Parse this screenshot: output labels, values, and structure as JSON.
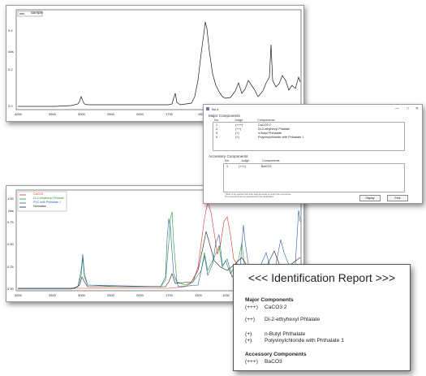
{
  "top_window": {
    "legend_label": "Sample",
    "y_unit": "Abs",
    "y_ticks": [
      "0.4",
      "0.2",
      "0.0"
    ],
    "x_ticks": [
      "4000",
      "3500",
      "3000",
      "2500",
      "2000",
      "1700",
      "1500"
    ]
  },
  "dialog": {
    "title": "No.4",
    "controls": [
      "—",
      "□",
      "✕"
    ],
    "major_heading": "Major Components",
    "columns": [
      "No.",
      "Judge",
      "Components"
    ],
    "major_rows": [
      {
        "no": "1",
        "judge": "(+++)",
        "name": "CaCO3 2"
      },
      {
        "no": "2",
        "judge": "(++)",
        "name": "Di-2-ethyhexyl Phtalate"
      },
      {
        "no": "3",
        "judge": "(+)",
        "name": "n-Butyl Phthalate"
      },
      {
        "no": "4",
        "judge": "(+)",
        "name": "Polyvinylchloride with Phthalate 1"
      }
    ],
    "accessory_heading": "Accessory Components",
    "accessory_rows": [
      {
        "no": "1",
        "judge": "(+++)",
        "name": "BaCO3"
      }
    ],
    "note_line1": "* Refer to the spectrum and other analysis results to confirm the components.",
    "note_line2": "  The components are not guaranteed by this identification.",
    "buttons": {
      "display": "Display",
      "print": "Print"
    }
  },
  "bottom_window": {
    "legend": [
      {
        "label": "CaCO3",
        "color": "#e03020"
      },
      {
        "label": "Di-2-ethylhexyl Phtalate",
        "color": "#2a9a2a"
      },
      {
        "label": "PVC with Phthalate 1",
        "color": "#2a5ab0"
      },
      {
        "label": "Normalize",
        "color": "#222222"
      }
    ],
    "y_unit": "Abs",
    "y_ticks": [
      "1.00",
      "0.75",
      "0.50",
      "0.25",
      "0.00"
    ],
    "x_ticks": [
      "4000",
      "3500",
      "3000",
      "2500",
      "2000",
      "1700",
      "1500",
      "1250"
    ]
  },
  "report": {
    "title": "<<< Identification Report >>>",
    "major_heading": "Major Components",
    "major_items": [
      {
        "judge": "(+++)",
        "name": "CaCO3 2"
      },
      {
        "judge": "(++)",
        "name": "Di-2-ethyhexyl Phtalate"
      },
      {
        "judge": "(+)",
        "name": "n-Butyl Phthalate"
      },
      {
        "judge": "(+)",
        "name": "Polyvinylchloride with Phthalate 1"
      }
    ],
    "accessory_heading": "Accessory Components",
    "accessory_items": [
      {
        "judge": "(+++)",
        "name": "BaCO3"
      }
    ]
  }
}
